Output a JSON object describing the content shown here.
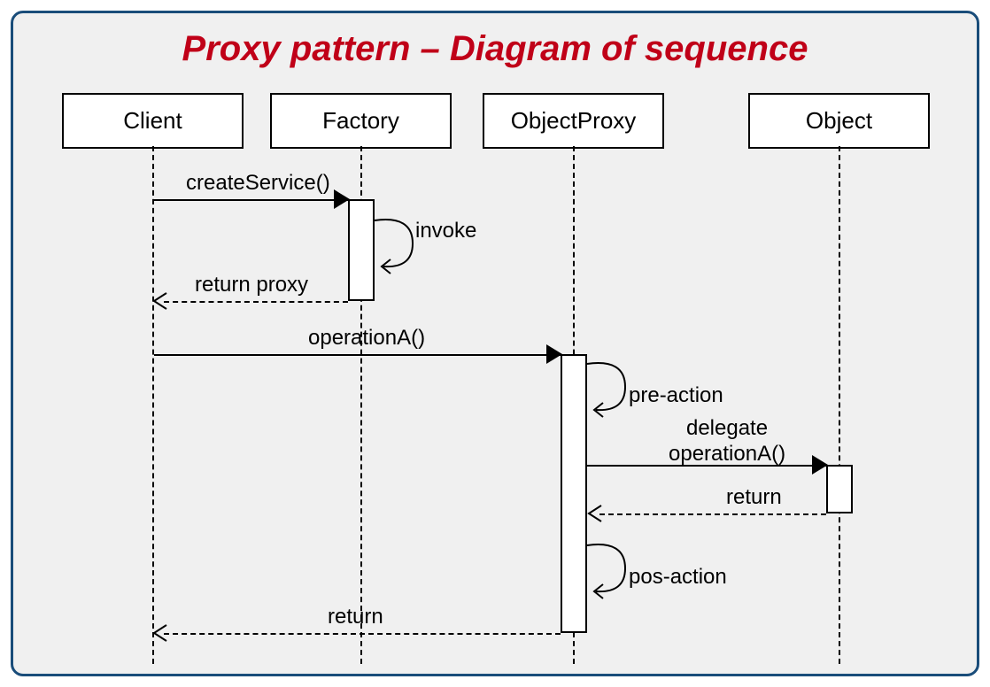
{
  "title": "Proxy pattern – Diagram of sequence",
  "participants": {
    "client": "Client",
    "factory": "Factory",
    "objectProxy": "ObjectProxy",
    "object": "Object"
  },
  "messages": {
    "createService": "createService()",
    "invoke": "invoke",
    "returnProxy": "return proxy",
    "operationA": "operationA()",
    "preAction": "pre-action",
    "delegateOperationA": "delegate\noperationA()",
    "return1": "return",
    "posAction": "pos-action",
    "return2": "return"
  }
}
